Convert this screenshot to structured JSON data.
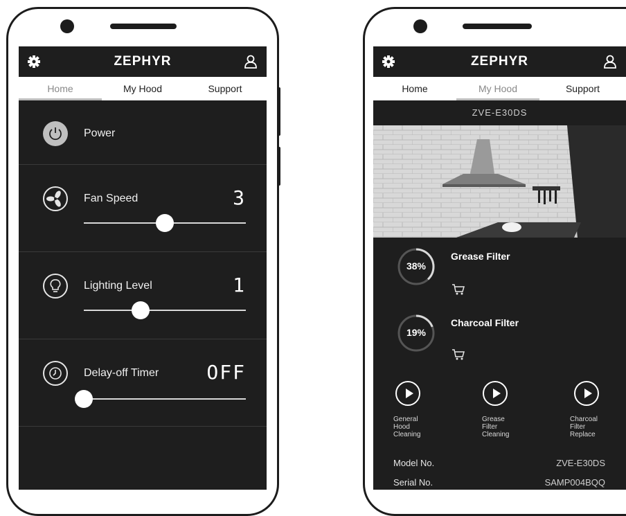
{
  "header": {
    "brand": "ZEPHYR"
  },
  "tabs": [
    {
      "label": "Home"
    },
    {
      "label": "My Hood"
    },
    {
      "label": "Support"
    }
  ],
  "home": {
    "power": {
      "label": "Power",
      "icon": "power-icon"
    },
    "fan": {
      "label": "Fan Speed",
      "value": "3",
      "slider_level": 0.5,
      "icon": "fan-icon"
    },
    "light": {
      "label": "Lighting Level",
      "value": "1",
      "slider_level": 0.35,
      "icon": "bulb-icon"
    },
    "timer": {
      "label": "Delay-off Timer",
      "value": "OFF",
      "slider_level": 0.0,
      "icon": "clock-icon"
    }
  },
  "myhood": {
    "model_title": "ZVE-E30DS",
    "filters": [
      {
        "name": "Grease Filter",
        "percent": "38%",
        "level": 0.38
      },
      {
        "name": "Charcoal Filter",
        "percent": "19%",
        "level": 0.19
      }
    ],
    "videos": [
      {
        "label": "General\nHood\nCleaning"
      },
      {
        "label": "Grease\nFilter\nCleaning"
      },
      {
        "label": "Charcoal\nFilter\nReplace"
      }
    ],
    "info": [
      {
        "label": "Model No.",
        "value": "ZVE-E30DS"
      },
      {
        "label": "Serial No.",
        "value": "SAMP004BQQ"
      }
    ]
  },
  "colors": {
    "screen_bg": "#1e1e1e",
    "tab_bg": "#ffffff",
    "accent": "#ffffff"
  }
}
